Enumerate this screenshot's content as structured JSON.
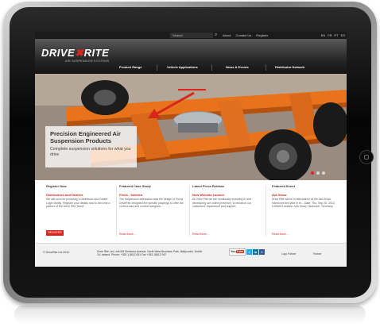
{
  "topbar": {
    "search_placeholder": "Search",
    "links": [
      "About",
      "Contact Us",
      "Register"
    ],
    "languages": [
      "EN",
      "FR",
      "PT",
      "ES"
    ]
  },
  "header": {
    "logo_left": "DRIVE",
    "logo_right": "RITE",
    "logo_sub": "AIR SUSPENSION SYSTEMS",
    "nav": [
      "Product Range",
      "Vehicle Applications",
      "News & Events",
      "Distributor Network"
    ]
  },
  "hero": {
    "title": "Precision Engineered Air Suspension Products",
    "subtitle": "Complete suspension solutions for what you drive",
    "slides": 3,
    "active_slide": 1
  },
  "columns": [
    {
      "heading": "Register Now",
      "title": "Distributors and Dealers",
      "body": "We will soon be providing a Distributor and Dealer Login facility. Register your details now to become a partner of the Drive Rite Team!",
      "action": "REGISTER"
    },
    {
      "heading": "Featured Case Study",
      "title": "Fiona - Sweden",
      "body": "The suspension fabrication was the design of Fiona. DriveRite designed the specific playrings to offer the correct load and comfort weighed...",
      "action": "Read More..."
    },
    {
      "heading": "Latest Press Release",
      "title": "New Website Launch",
      "body": "At Drive Rite we are continually investing in and developing our online presence, to enhance our customers' experience and support.",
      "action": "Read More..."
    },
    {
      "heading": "Featured Event",
      "title": "IAA Show",
      "body": "Drive Rite will be in attendance at the IAA Show, Hannover this year in th...  Date: Thu, Sep 20, 2012, 9:00AM  Location: IAA Show, Hannover, Germany",
      "action": "Read More..."
    }
  ],
  "footer": {
    "copyright": "© DriveRite Ltd 2012",
    "address": "Drive Rite Ltd, Unit 6/8 Shelsone Avenue, North West Business Park, Ballycoolin, Dublin 15, Ireland. Phone: +353 1 8612 631 Fax +353 18612 947",
    "social": [
      "You",
      "Tube",
      "t",
      "in",
      "f"
    ],
    "partners": [
      "Logo Partner",
      "Partner"
    ]
  },
  "colors": {
    "accent": "#d9261c",
    "chassis": "#e8731a",
    "header_dark": "#1b1b1b"
  },
  "icons": [
    "search-icon",
    "home-button-icon"
  ]
}
